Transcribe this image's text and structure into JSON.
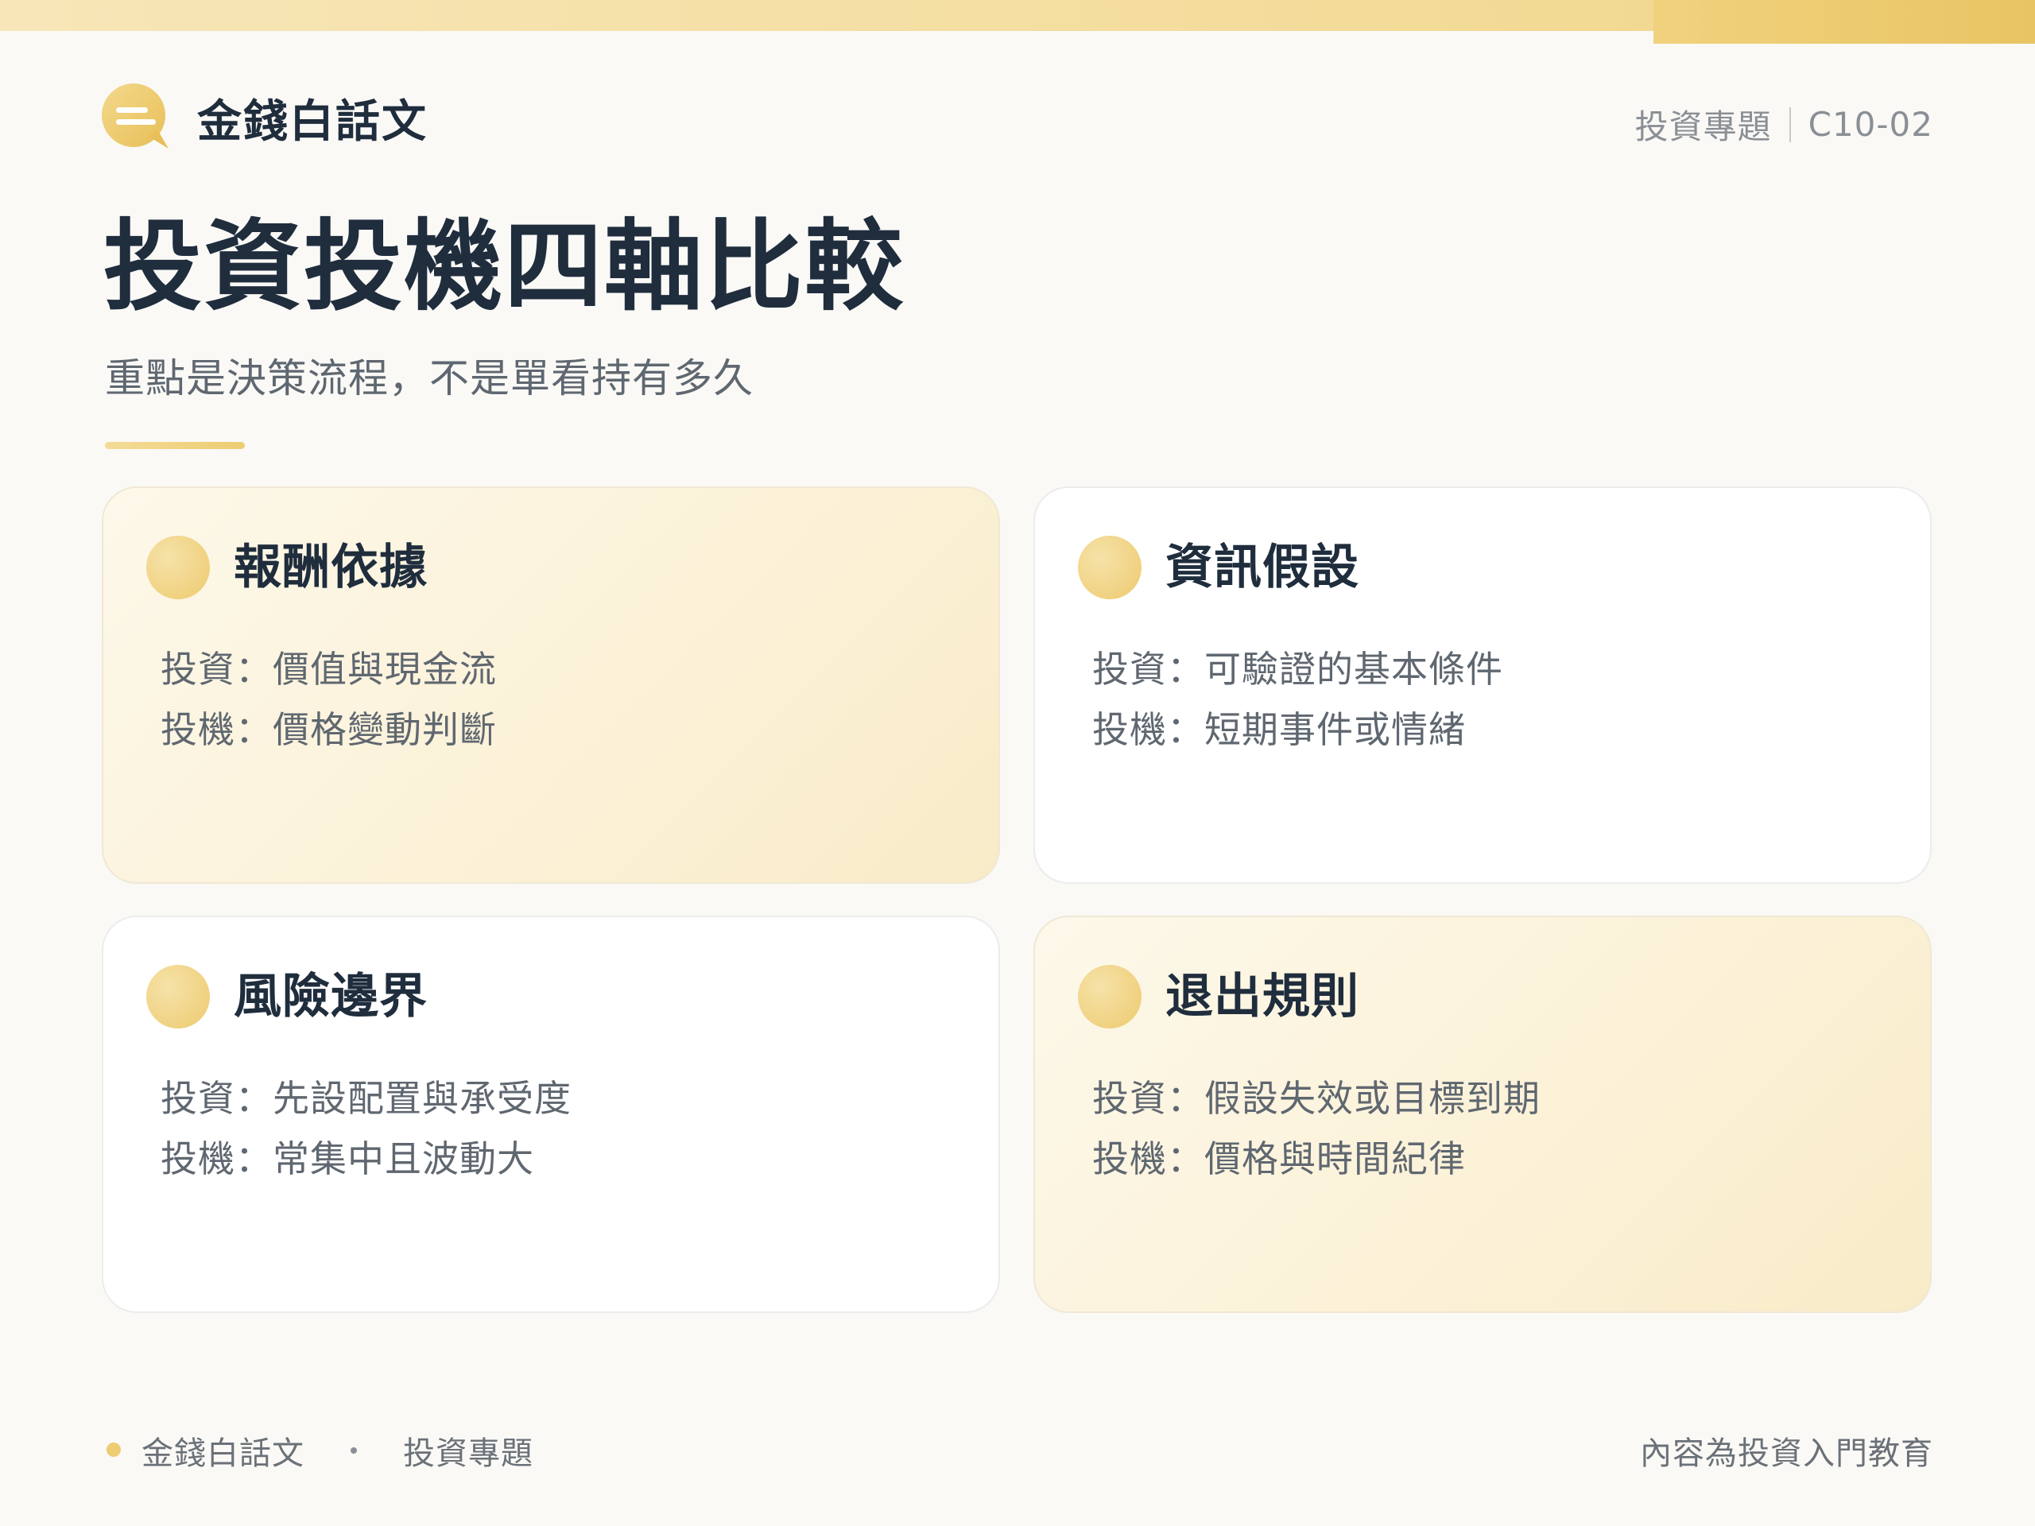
{
  "brand": {
    "name": "金錢白話文",
    "logo_icon": "chat-bubble-icon"
  },
  "header": {
    "topic": "投資專題",
    "code": "C10-02"
  },
  "page": {
    "title": "投資投機四軸比較",
    "subtitle": "重點是決策流程，不是單看持有多久"
  },
  "cards": [
    {
      "title": "報酬依據",
      "lines": [
        "投資：價值與現金流",
        "投機：價格變動判斷"
      ]
    },
    {
      "title": "資訊假設",
      "lines": [
        "投資：可驗證的基本條件",
        "投機：短期事件或情緒"
      ]
    },
    {
      "title": "風險邊界",
      "lines": [
        "投資：先設配置與承受度",
        "投機：常集中且波動大"
      ]
    },
    {
      "title": "退出規則",
      "lines": [
        "投資：假設失效或目標到期",
        "投機：價格與時間紀律"
      ]
    }
  ],
  "footer": {
    "brand": "金錢白話文",
    "topic": "投資專題",
    "note": "內容為投資入門教育"
  },
  "colors": {
    "accent": "#edcc72",
    "accent_light": "#f7e6b8",
    "text_dark": "#1f2d3d",
    "text_muted": "#5f6770"
  }
}
